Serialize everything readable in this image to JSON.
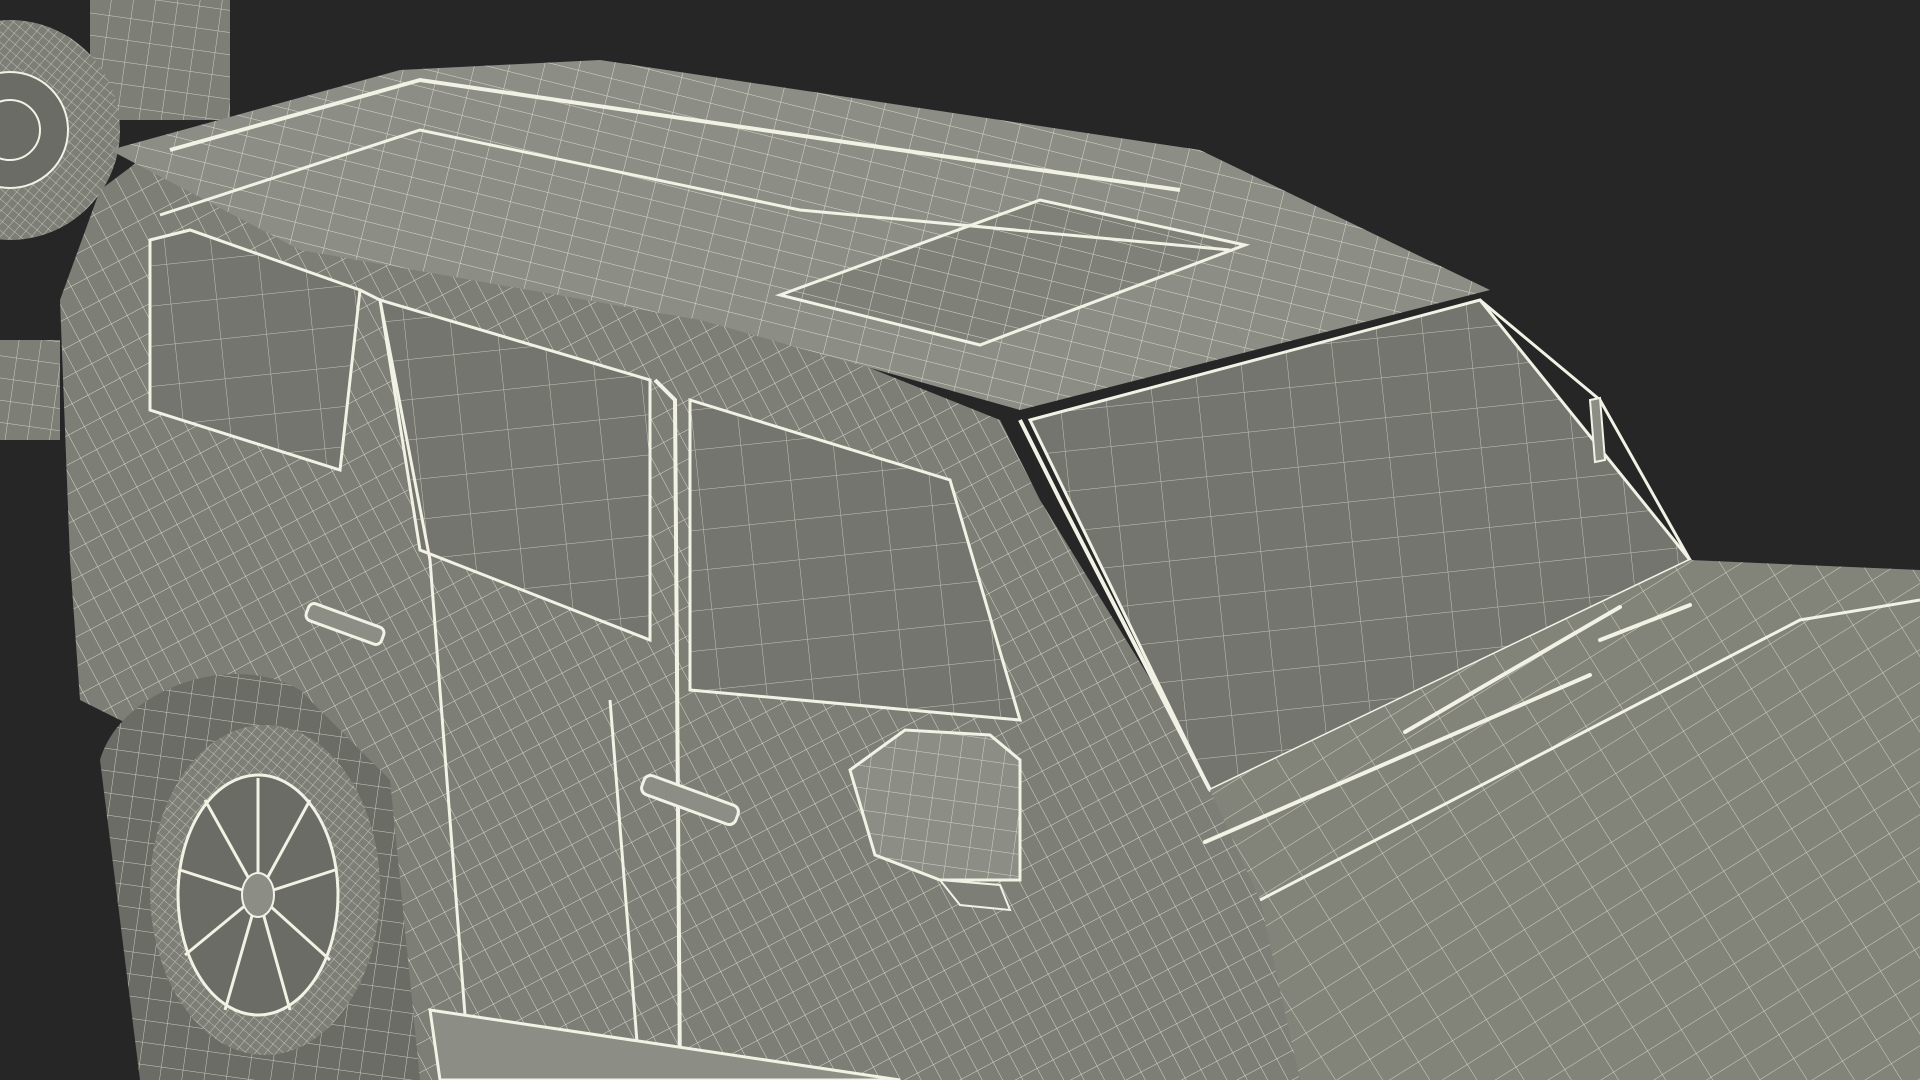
{
  "scene": {
    "subject": "suv-wireframe-render",
    "colors": {
      "background": "#262626",
      "surface": "#7d7e76",
      "surface_dark": "#6b6c65",
      "surface_light": "#8c8d85",
      "glass": "#74756e",
      "wire": "#f2f2e4",
      "wire_soft": "#d8d9cc"
    },
    "icons": [
      "wheel-icon",
      "side-mirror-icon",
      "door-handle-icon",
      "wiper-icon",
      "sunroof-icon"
    ]
  }
}
